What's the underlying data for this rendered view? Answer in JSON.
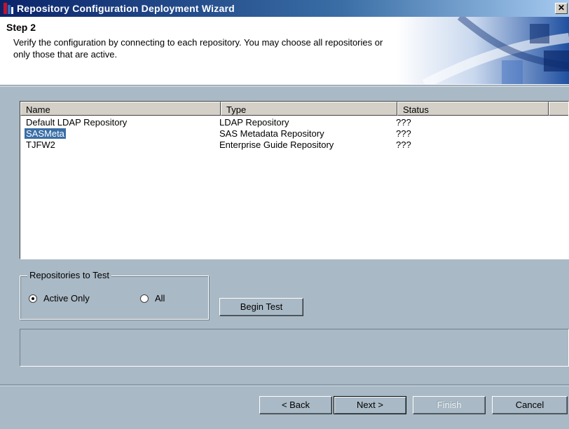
{
  "window": {
    "title": "Repository Configuration Deployment Wizard",
    "close_label": "✕",
    "colors": {
      "titlebar": "#0a246a",
      "face": "#a9b9c5",
      "selection": "#3a6ea5"
    }
  },
  "header": {
    "step_title": "Step 2",
    "description": "Verify the configuration by connecting to each repository. You may choose all repositories or only those that are active."
  },
  "list": {
    "columns": [
      "Name",
      "Type",
      "Status"
    ],
    "rows": [
      {
        "name": "Default LDAP Repository",
        "type": "LDAP Repository",
        "status": "???",
        "selected": false
      },
      {
        "name": "SASMeta",
        "type": "SAS Metadata Repository",
        "status": "???",
        "selected": true
      },
      {
        "name": "TJFW2",
        "type": "Enterprise Guide Repository",
        "status": "???",
        "selected": false
      }
    ]
  },
  "test_options": {
    "group_label": "Repositories to Test",
    "options": [
      {
        "label": "Active Only",
        "checked": true
      },
      {
        "label": "All",
        "checked": false
      }
    ],
    "begin_test_label": "Begin Test"
  },
  "status_panel": {
    "text": ""
  },
  "footer": {
    "back_label": "< Back",
    "next_label": "Next >",
    "finish_label": "Finish",
    "cancel_label": "Cancel"
  }
}
